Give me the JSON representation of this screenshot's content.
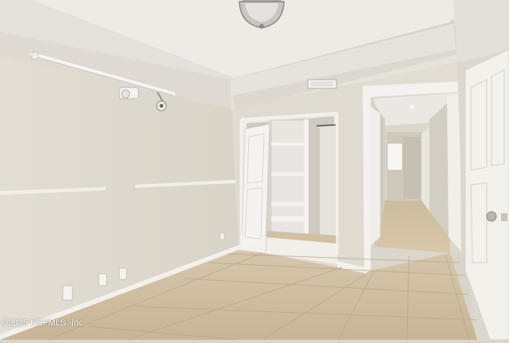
{
  "photo": {
    "watermark": "©2025 NEFMLS, Inc."
  }
}
